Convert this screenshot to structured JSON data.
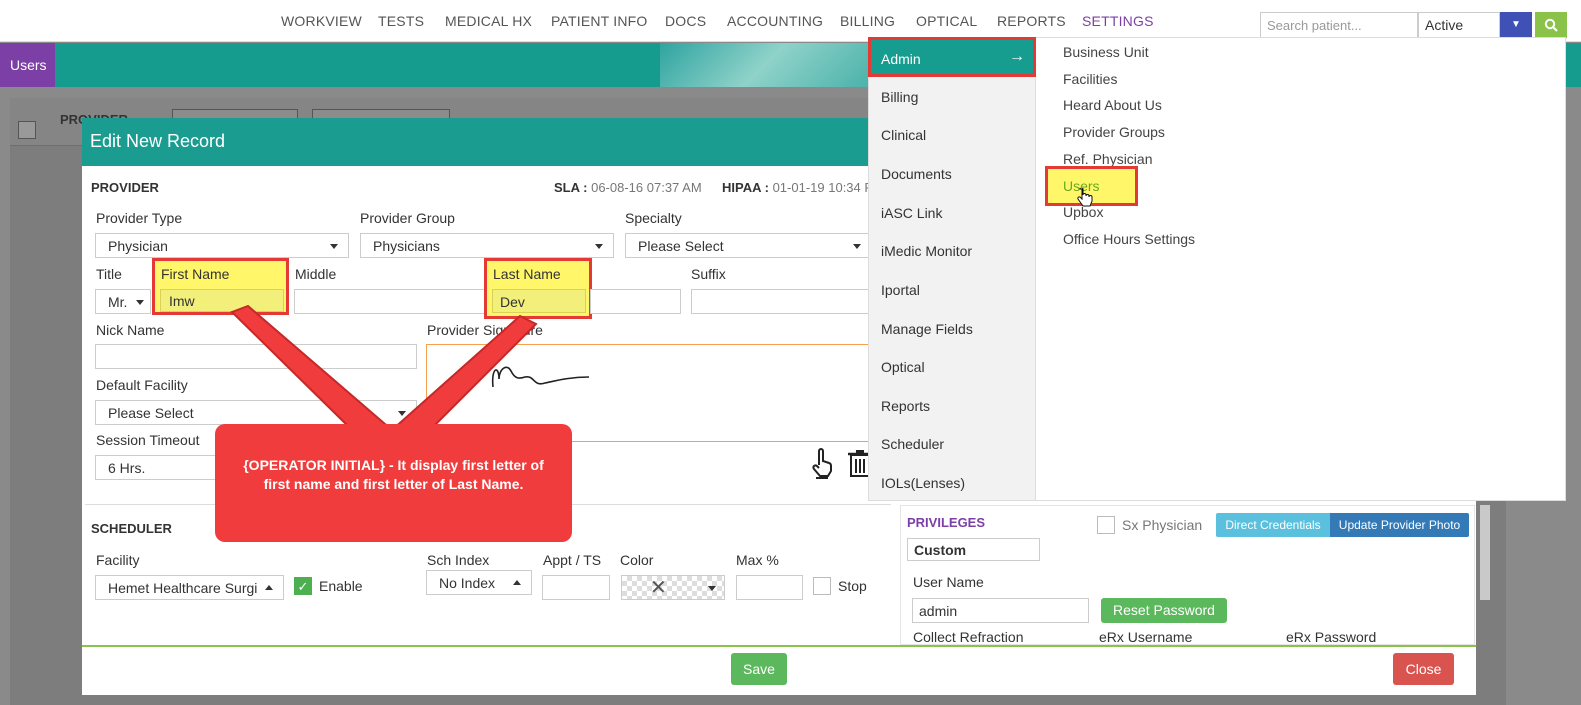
{
  "topnav": {
    "items": [
      "WORKVIEW",
      "TESTS",
      "MEDICAL HX",
      "PATIENT INFO",
      "DOCS",
      "ACCOUNTING",
      "BILLING",
      "OPTICAL",
      "REPORTS",
      "SETTINGS"
    ],
    "active": "SETTINGS",
    "search_placeholder": "Search patient...",
    "status_value": "Active"
  },
  "subbar": {
    "users_tab": "Users"
  },
  "background": {
    "provider_header": "PROVIDER"
  },
  "modal": {
    "title": "Edit New Record",
    "provider": {
      "section": "PROVIDER",
      "sla_label": "SLA :",
      "sla_value": "06-08-16 07:37 AM",
      "hipaa_label": "HIPAA :",
      "hipaa_value": "01-01-19 10:34 F",
      "provider_type_label": "Provider Type",
      "provider_type_value": "Physician",
      "provider_group_label": "Provider Group",
      "provider_group_value": "Physicians",
      "specialty_label": "Specialty",
      "specialty_value": "Please Select",
      "title_label": "Title",
      "title_value": "Mr.",
      "first_name_label": "First Name",
      "first_name_value": "Imw",
      "middle_label": "Middle",
      "last_name_label": "Last Name",
      "last_name_value": "Dev",
      "suffix_label": "Suffix",
      "nick_name_label": "Nick Name",
      "signature_label": "Provider Signature",
      "default_facility_label": "Default Facility",
      "default_facility_value": "Please Select",
      "session_timeout_label": "Session Timeout",
      "session_timeout_value": "6 Hrs."
    },
    "scheduler": {
      "section": "SCHEDULER",
      "facility_label": "Facility",
      "facility_value": "Hemet Healthcare Surgi",
      "enable_label": "Enable",
      "sch_index_label": "Sch Index",
      "sch_index_value": "No Index",
      "appt_label": "Appt / TS",
      "color_label": "Color",
      "max_label": "Max %",
      "stop_label": "Stop"
    },
    "privileges": {
      "section": "PRIVILEGES",
      "sx_physician_label": "Sx Physician",
      "direct_credentials": "Direct Credentials",
      "update_photo": "Update Provider Photo",
      "privilege_value": "Custom",
      "username_label": "User Name",
      "username_value": "admin",
      "reset_password": "Reset Password",
      "collect_refraction": "Collect Refraction",
      "erx_username": "eRx Username",
      "erx_password": "eRx Password"
    },
    "save": "Save",
    "close": "Close"
  },
  "callout": {
    "text": "{OPERATOR INITIAL} - It display first letter of first name and first letter of Last Name."
  },
  "settings_menu": {
    "left": [
      "Admin",
      "Billing",
      "Clinical",
      "Documents",
      "iASC Link",
      "iMedic Monitor",
      "Iportal",
      "Manage Fields",
      "Optical",
      "Reports",
      "Scheduler",
      "IOLs(Lenses)"
    ],
    "right": [
      "Business Unit",
      "Facilities",
      "Heard About Us",
      "Provider Groups",
      "Ref. Physician",
      "Users",
      "Upbox",
      "Office Hours Settings"
    ],
    "admin_arrow": "→"
  },
  "colors": {
    "teal": "#1a9d90",
    "purple": "#7b3fa6",
    "callout_red": "#f03c3c",
    "highlight": "#fff66a",
    "save_green": "#5cb85c",
    "close_red": "#d9534f"
  },
  "icons": [
    "hand-pointer-icon",
    "trash-icon",
    "cursor-hand-icon",
    "search-icon",
    "caret-down-icon",
    "arrow-right-icon",
    "check-icon"
  ]
}
